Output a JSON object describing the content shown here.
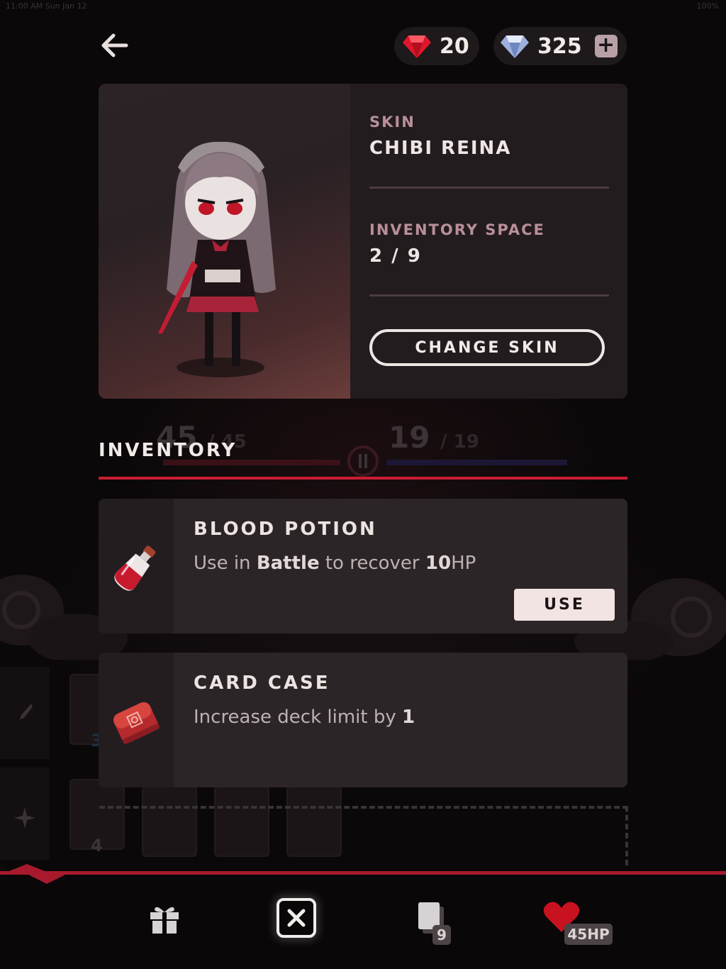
{
  "status_bar": {
    "left": "11:00 AM  Sun Jan 12",
    "right": "100%"
  },
  "currency": {
    "ruby": {
      "icon": "ruby-icon",
      "value": "20",
      "color": "#e0172c"
    },
    "diamond": {
      "icon": "diamond-icon",
      "value": "325",
      "color": "#b9c7e6"
    },
    "add_label": "+"
  },
  "skin": {
    "skin_label": "SKIN",
    "skin_name": "CHIBI REINA",
    "inventory_space_label": "INVENTORY SPACE",
    "inventory_space_value": "2 / 9",
    "change_skin_label": "CHANGE SKIN"
  },
  "inventory": {
    "title": "INVENTORY",
    "accent": "#c91d33",
    "items": [
      {
        "name": "BLOOD POTION",
        "desc_parts": [
          "Use in ",
          "Battle",
          " to recover ",
          "10",
          "HP"
        ],
        "icon": "blood-potion-icon",
        "action_label": "USE"
      },
      {
        "name": "CARD CASE",
        "desc_parts": [
          "Increase deck limit by ",
          "1"
        ],
        "icon": "card-case-icon"
      }
    ]
  },
  "background_stats": {
    "hp_current": "45",
    "hp_max": "/ 45",
    "energy_current": "19",
    "energy_max": "/ 19",
    "card_count_a": "3",
    "card_count_b": "4"
  },
  "bottom_nav": {
    "gift_icon": "gift-icon",
    "close_icon": "close-icon",
    "deck_icon": "card-deck-icon",
    "deck_count": "9",
    "heart_icon": "heart-icon",
    "hp_badge": "45HP"
  }
}
